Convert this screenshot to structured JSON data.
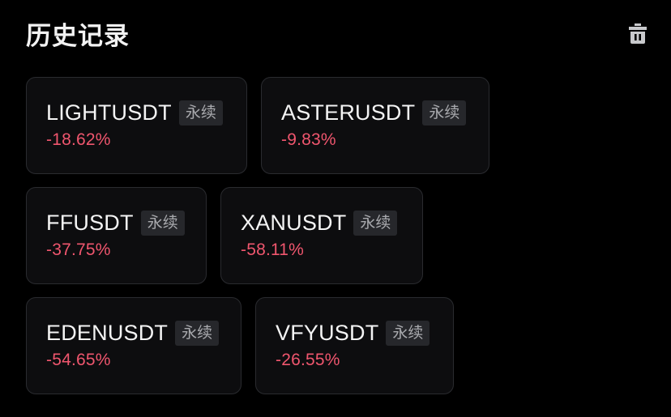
{
  "header": {
    "title": "历史记录",
    "clear_icon": "trash-icon"
  },
  "colors": {
    "background": "#000000",
    "card_background": "#0d0d0f",
    "card_border": "#2a2b2f",
    "negative": "#f0566e",
    "tag_background": "#26272b",
    "tag_text": "#a8a9ad"
  },
  "history": [
    {
      "symbol": "LIGHTUSDT",
      "tag": "永续",
      "change": "-18.62%"
    },
    {
      "symbol": "ASTERUSDT",
      "tag": "永续",
      "change": "-9.83%"
    },
    {
      "symbol": "FFUSDT",
      "tag": "永续",
      "change": "-37.75%"
    },
    {
      "symbol": "XANUSDT",
      "tag": "永续",
      "change": "-58.11%"
    },
    {
      "symbol": "EDENUSDT",
      "tag": "永续",
      "change": "-54.65%"
    },
    {
      "symbol": "VFYUSDT",
      "tag": "永续",
      "change": "-26.55%"
    }
  ]
}
